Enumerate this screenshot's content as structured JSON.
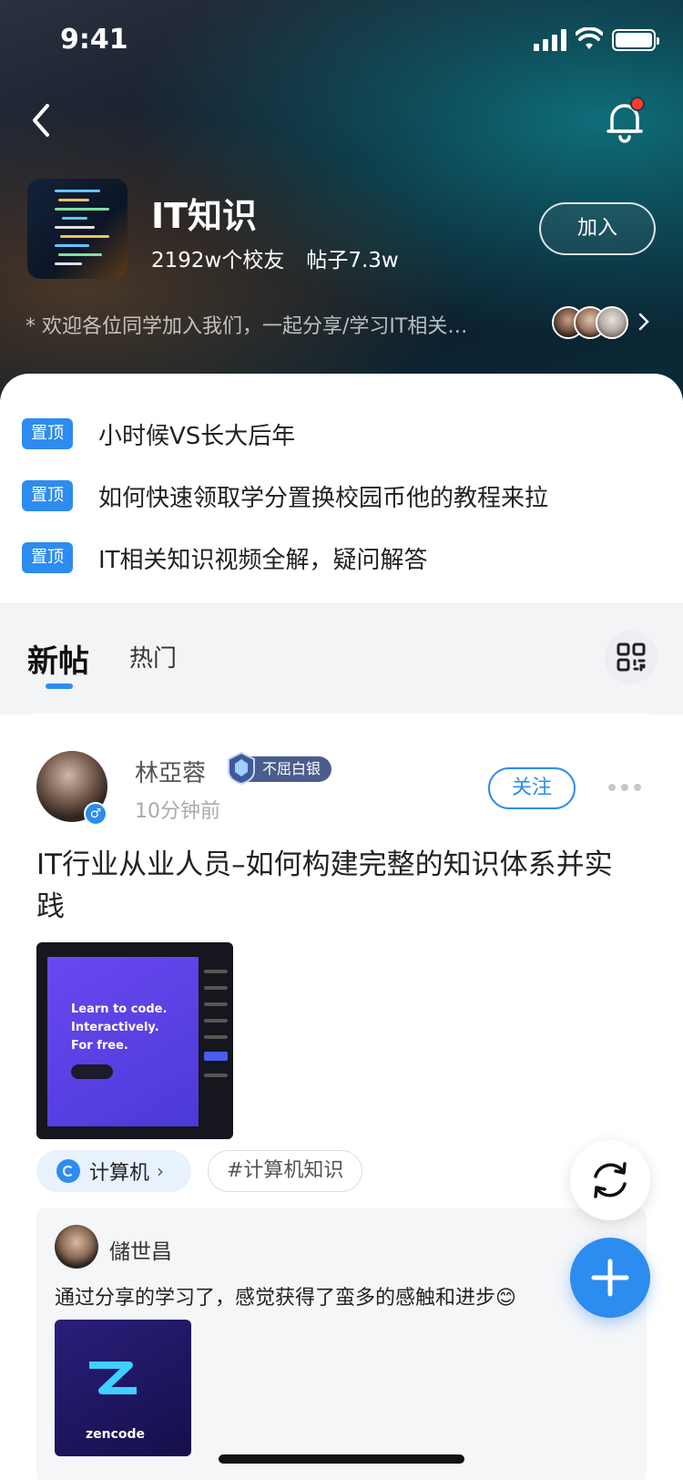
{
  "status_bar": {
    "time": "9:41",
    "battery_level": 1.0
  },
  "group": {
    "name": "IT知识",
    "members": "2192w个校友",
    "posts": "帖子7.3w",
    "join_label": "加入",
    "description": "* 欢迎各位同学加入我们，一起分享/学习IT相关…"
  },
  "pinned": {
    "badge": "置顶",
    "items": [
      "小时候VS长大后年",
      "如何快速领取学分置换校园币他的教程来拉",
      "IT相关知识视频全解，疑问解答"
    ]
  },
  "tabs": {
    "new": "新帖",
    "hot": "热门"
  },
  "post": {
    "author": "林亞蓉",
    "gender_symbol": "♂",
    "rank": "不屈白银",
    "time": "10分钟前",
    "follow_label": "关注",
    "title": "IT行业从业人员–如何构建完整的知识体系并实践",
    "image_text": [
      "Learn to code.",
      "Interactively.",
      "For free."
    ],
    "category": "计算机",
    "category_chevron": "›",
    "hashtag": "#计算机知识",
    "comment": {
      "author": "儲世昌",
      "text": "通过分享的学习了，感觉获得了蛮多的感触和进步😊",
      "image_brand": "zencode"
    }
  },
  "colors": {
    "accent": "#2d8cf0",
    "notification_dot": "#ff3b30"
  }
}
